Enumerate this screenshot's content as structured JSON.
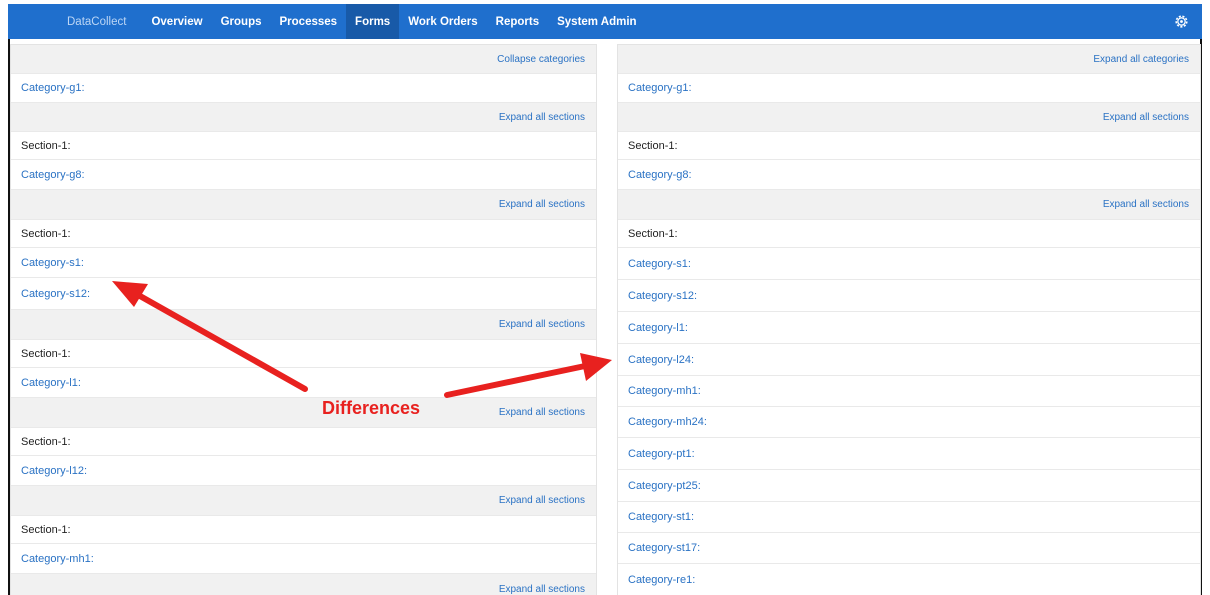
{
  "navbar": {
    "brand": "DataCollect",
    "items": [
      "Overview",
      "Groups",
      "Processes",
      "Forms",
      "Work Orders",
      "Reports",
      "System Admin"
    ],
    "active_index": 3,
    "settings_icon": "gear-icon"
  },
  "left_panel": {
    "rows": [
      {
        "kind": "action",
        "text": "Collapse categories"
      },
      {
        "kind": "category",
        "text": "Category-g1:"
      },
      {
        "kind": "action",
        "text": "Expand all sections"
      },
      {
        "kind": "section",
        "text": "Section-1:"
      },
      {
        "kind": "category",
        "text": "Category-g8:"
      },
      {
        "kind": "action",
        "text": "Expand all sections"
      },
      {
        "kind": "section",
        "text": "Section-1:"
      },
      {
        "kind": "category",
        "text": "Category-s1:"
      },
      {
        "kind": "category",
        "text": "Category-s12:"
      },
      {
        "kind": "action",
        "text": "Expand all sections"
      },
      {
        "kind": "section",
        "text": "Section-1:"
      },
      {
        "kind": "category",
        "text": "Category-l1:"
      },
      {
        "kind": "action",
        "text": "Expand all sections"
      },
      {
        "kind": "section",
        "text": "Section-1:"
      },
      {
        "kind": "category",
        "text": "Category-l12:"
      },
      {
        "kind": "action",
        "text": "Expand all sections"
      },
      {
        "kind": "section",
        "text": "Section-1:"
      },
      {
        "kind": "category",
        "text": "Category-mh1:"
      },
      {
        "kind": "action",
        "text": "Expand all sections"
      }
    ]
  },
  "right_panel": {
    "rows": [
      {
        "kind": "action",
        "text": "Expand all categories"
      },
      {
        "kind": "category",
        "text": "Category-g1:"
      },
      {
        "kind": "action",
        "text": "Expand all sections"
      },
      {
        "kind": "section",
        "text": "Section-1:"
      },
      {
        "kind": "category",
        "text": "Category-g8:"
      },
      {
        "kind": "action",
        "text": "Expand all sections"
      },
      {
        "kind": "section",
        "text": "Section-1:"
      },
      {
        "kind": "category",
        "text": "Category-s1:"
      },
      {
        "kind": "category",
        "text": "Category-s12:"
      },
      {
        "kind": "category",
        "text": "Category-l1:"
      },
      {
        "kind": "category",
        "text": "Category-l24:"
      },
      {
        "kind": "category",
        "text": "Category-mh1:"
      },
      {
        "kind": "category",
        "text": "Category-mh24:"
      },
      {
        "kind": "category",
        "text": "Category-pt1:"
      },
      {
        "kind": "category",
        "text": "Category-pt25:"
      },
      {
        "kind": "category",
        "text": "Category-st1:"
      },
      {
        "kind": "category",
        "text": "Category-st17:"
      },
      {
        "kind": "category",
        "text": "Category-re1:"
      }
    ]
  },
  "annotation": {
    "label": "Differences",
    "color": "#e8211f"
  },
  "colors": {
    "navbar": "#1f6fcd",
    "link": "#2a72c4",
    "action_bg": "#f1f1f1"
  }
}
